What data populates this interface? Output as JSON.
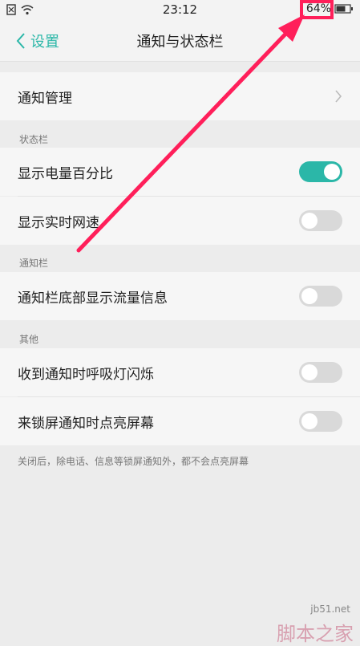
{
  "status_bar": {
    "time": "23:12",
    "battery_percent": "64%",
    "icons": [
      "sim-icon",
      "wifi-icon",
      "battery-icon"
    ]
  },
  "nav": {
    "back_label": "设置",
    "title": "通知与状态栏"
  },
  "rows": {
    "notify_manage": "通知管理"
  },
  "sections": {
    "status_bar": {
      "header": "状态栏",
      "items": [
        {
          "label": "显示电量百分比",
          "toggle_on": true
        },
        {
          "label": "显示实时网速",
          "toggle_on": false
        }
      ]
    },
    "notification_bar": {
      "header": "通知栏",
      "items": [
        {
          "label": "通知栏底部显示流量信息",
          "toggle_on": false
        }
      ]
    },
    "other": {
      "header": "其他",
      "items": [
        {
          "label": "收到通知时呼吸灯闪烁",
          "toggle_on": false
        },
        {
          "label": "来锁屏通知时点亮屏幕",
          "toggle_on": false
        }
      ]
    }
  },
  "footer_note": "关闭后，除电话、信息等锁屏通知外，都不会点亮屏幕",
  "watermark": {
    "site": "jb51.net",
    "brand": "脚本之家"
  },
  "colors": {
    "accent": "#2bb7a8",
    "annotation": "#ff1f5a"
  }
}
